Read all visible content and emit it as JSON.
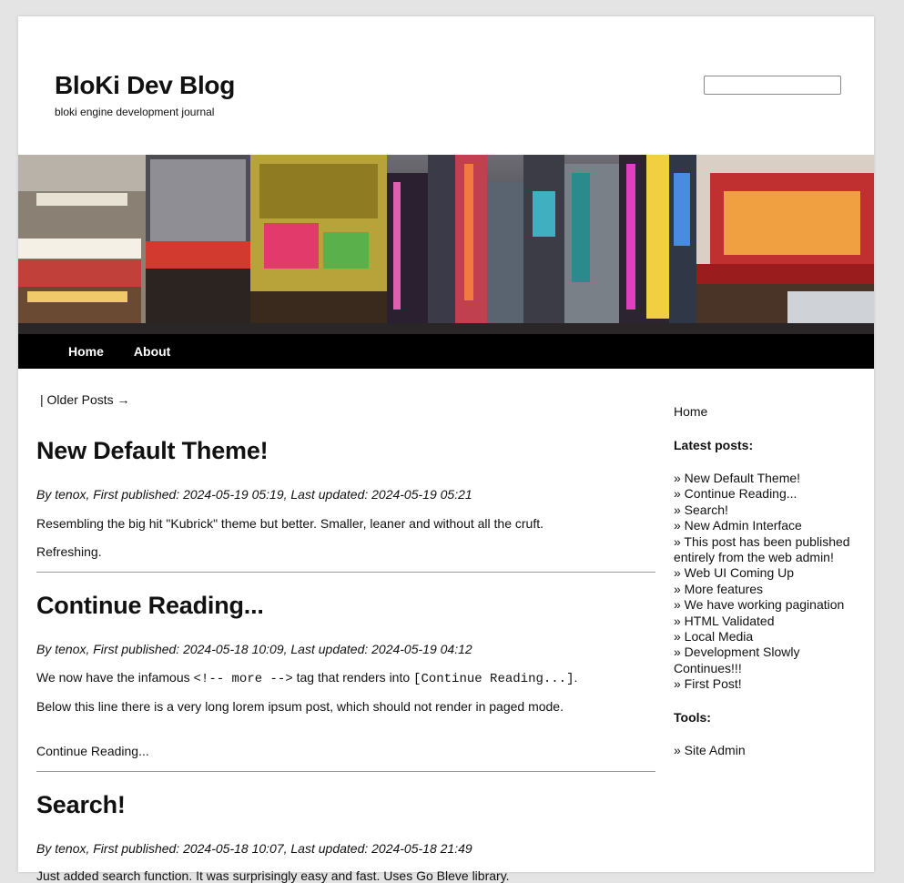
{
  "header": {
    "title": "BloKi Dev Blog",
    "tagline": "bloki engine development journal",
    "search_placeholder": ""
  },
  "nav": {
    "items": [
      "Home",
      "About"
    ]
  },
  "pager": {
    "separator": "| ",
    "older": "Older Posts →"
  },
  "posts": [
    {
      "title": "New Default Theme!",
      "meta": "By tenox, First published: 2024-05-19 05:19, Last updated: 2024-05-19 05:21",
      "p1": "Resembling the big hit \"Kubrick\" theme but better. Smaller, leaner and without all the cruft.",
      "p2": "Refreshing."
    },
    {
      "title": "Continue Reading...",
      "meta": "By tenox, First published: 2024-05-18 10:09, Last updated: 2024-05-19 04:12",
      "p1_pre": "We now have the infamous ",
      "p1_code1": "<!-- more -->",
      "p1_mid": " tag that renders into ",
      "p1_code2": "[Continue Reading...]",
      "p1_post": ".",
      "p2": "Below this line there is a very long lorem ipsum post, which should not render in paged mode.",
      "more": "Continue Reading..."
    },
    {
      "title": "Search!",
      "meta": "By tenox, First published: 2024-05-18 10:07, Last updated: 2024-05-18 21:49",
      "p1": "Just added search function. It was surprisingly easy and fast. Uses Go Bleve library."
    }
  ],
  "sidebar": {
    "home": "Home",
    "latest_heading": "Latest posts:",
    "latest": [
      "» New Default Theme!",
      "» Continue Reading...",
      "» Search!",
      "» New Admin Interface",
      "» This post has been published entirely from the web admin!",
      "» Web UI Coming Up",
      "» More features",
      "» We have working pagination",
      "» HTML Validated",
      "» Local Media",
      "» Development Slowly Continues!!!",
      "» First Post!"
    ],
    "tools_heading": "Tools:",
    "tools": [
      "» Site Admin"
    ]
  }
}
